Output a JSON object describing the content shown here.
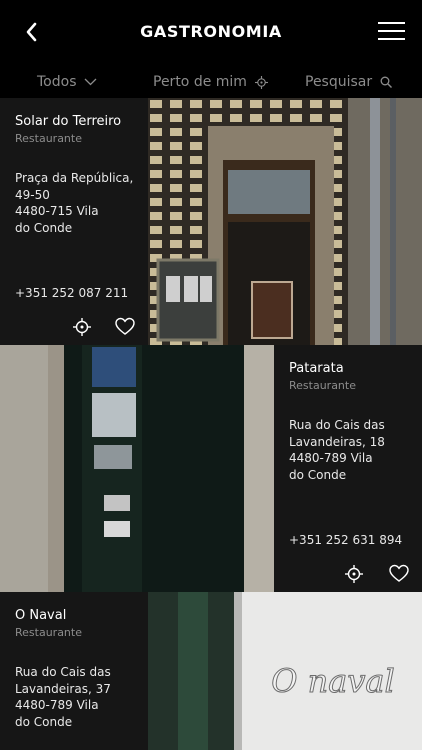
{
  "header": {
    "title": "GASTRONOMIA"
  },
  "filters": {
    "all": "Todos",
    "near": "Perto de mim",
    "search": "Pesquisar"
  },
  "restaurants": [
    {
      "name": "Solar do Terreiro",
      "type": "Restaurante",
      "address_lines": [
        "Praça da República,",
        "49-50",
        "4480-715 Vila",
        "do Conde"
      ],
      "phone": "+351 252 087 211"
    },
    {
      "name": "Patarata",
      "type": "Restaurante",
      "address_lines": [
        "Rua do Cais das",
        "Lavandeiras, 18",
        "4480-789 Vila",
        "do Conde"
      ],
      "phone": "+351 252 631 894"
    },
    {
      "name": "O Naval",
      "type": "Restaurante",
      "address_lines": [
        "Rua do Cais das",
        "Lavandeiras, 37",
        "4480-789 Vila",
        "do Conde"
      ]
    }
  ],
  "sign_text": "O naval"
}
